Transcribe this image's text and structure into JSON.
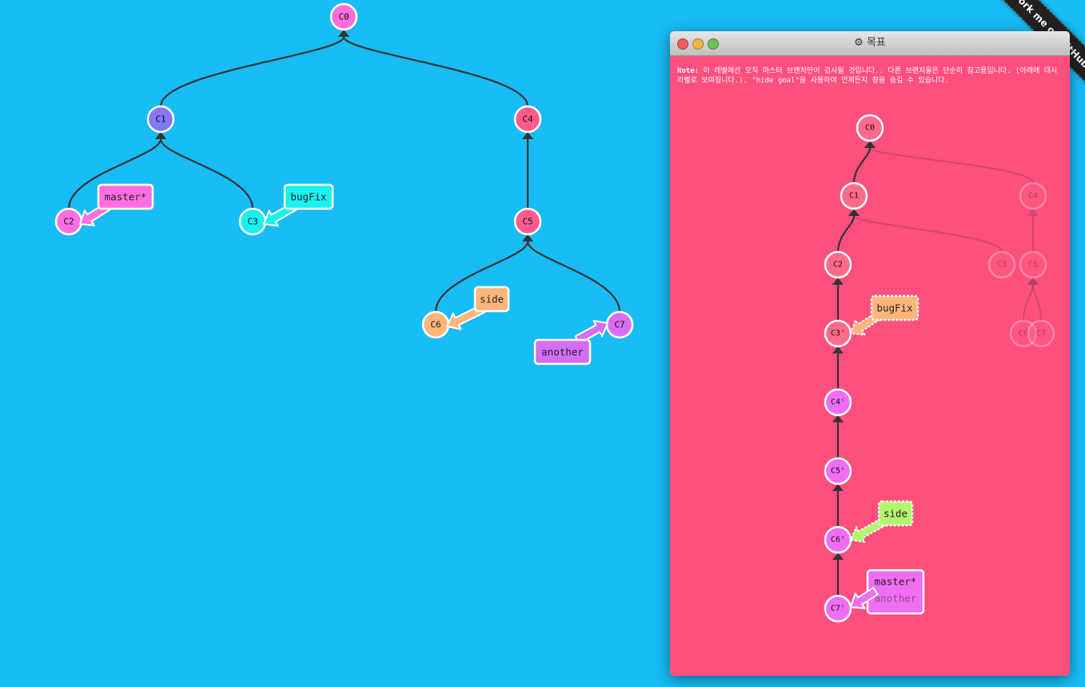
{
  "colors": {
    "background": "#18bcf6",
    "goal_window": "#ff4f7e",
    "edge": "#333333"
  },
  "ribbon_text": "Fork me on GitHub",
  "main_tree": {
    "commits": [
      {
        "id": "C0",
        "color": "#ff6fe2"
      },
      {
        "id": "C1",
        "color": "#8078f5"
      },
      {
        "id": "C2",
        "color": "#ff6fe2"
      },
      {
        "id": "C3",
        "color": "#1af0f0"
      },
      {
        "id": "C4",
        "color": "#ff5c8e"
      },
      {
        "id": "C5",
        "color": "#ff5c8e"
      },
      {
        "id": "C6",
        "color": "#ffb57a"
      },
      {
        "id": "C7",
        "color": "#d56ef4"
      }
    ],
    "branches": [
      {
        "name": "master*",
        "target": "C2",
        "color": "#ff6fe2"
      },
      {
        "name": "bugFix",
        "target": "C3",
        "color": "#1af0f0"
      },
      {
        "name": "side",
        "target": "C6",
        "color": "#ffb57a"
      },
      {
        "name": "another",
        "target": "C7",
        "color": "#d56ef4"
      }
    ]
  },
  "goal_window": {
    "title_icon": "gear-icon",
    "title": "목표",
    "note_label": "Note:",
    "note_text": " 이 레벨에선 오직 마스터 브랜치만이 검사될 것입니다.. 다른 브랜치들은 단순히 참고용입니다. (아래에 대시 라벨로 보여집니다.). \"hide goal\"을 사용하여 언제든지 창을 숨길 수 있습니다.",
    "commits": [
      {
        "id": "C0",
        "color": "#ff6b88",
        "faded": false
      },
      {
        "id": "C1",
        "color": "#ff6b88",
        "faded": false
      },
      {
        "id": "C2",
        "color": "#ff6b88",
        "faded": false
      },
      {
        "id": "C3'",
        "color": "#ff6b88",
        "faded": false
      },
      {
        "id": "C4'",
        "color": "#ef6ef2",
        "faded": false
      },
      {
        "id": "C5'",
        "color": "#ef6ef2",
        "faded": false
      },
      {
        "id": "C6'",
        "color": "#ef6ef2",
        "faded": false
      },
      {
        "id": "C7'",
        "color": "#ef6ef2",
        "faded": false
      },
      {
        "id": "C3",
        "color": "#ff6b88",
        "faded": true
      },
      {
        "id": "C4",
        "color": "#ff6b88",
        "faded": true
      },
      {
        "id": "C5",
        "color": "#ff6b88",
        "faded": true
      },
      {
        "id": "C6",
        "color": "#ff6b88",
        "faded": true
      },
      {
        "id": "C7",
        "color": "#ff6b88",
        "faded": true
      }
    ],
    "branches": [
      {
        "name": "bugFix",
        "target": "C3'",
        "color": "#ffb57a",
        "dashed": true
      },
      {
        "name": "side",
        "target": "C6'",
        "color": "#b4f56e",
        "dashed": true
      },
      {
        "name": "master*",
        "target": "C7'",
        "color": "#ef6ef2",
        "dashed": false
      },
      {
        "name": "another",
        "target": "C7'",
        "color": "#ef6ef2",
        "dashed": true
      }
    ]
  }
}
